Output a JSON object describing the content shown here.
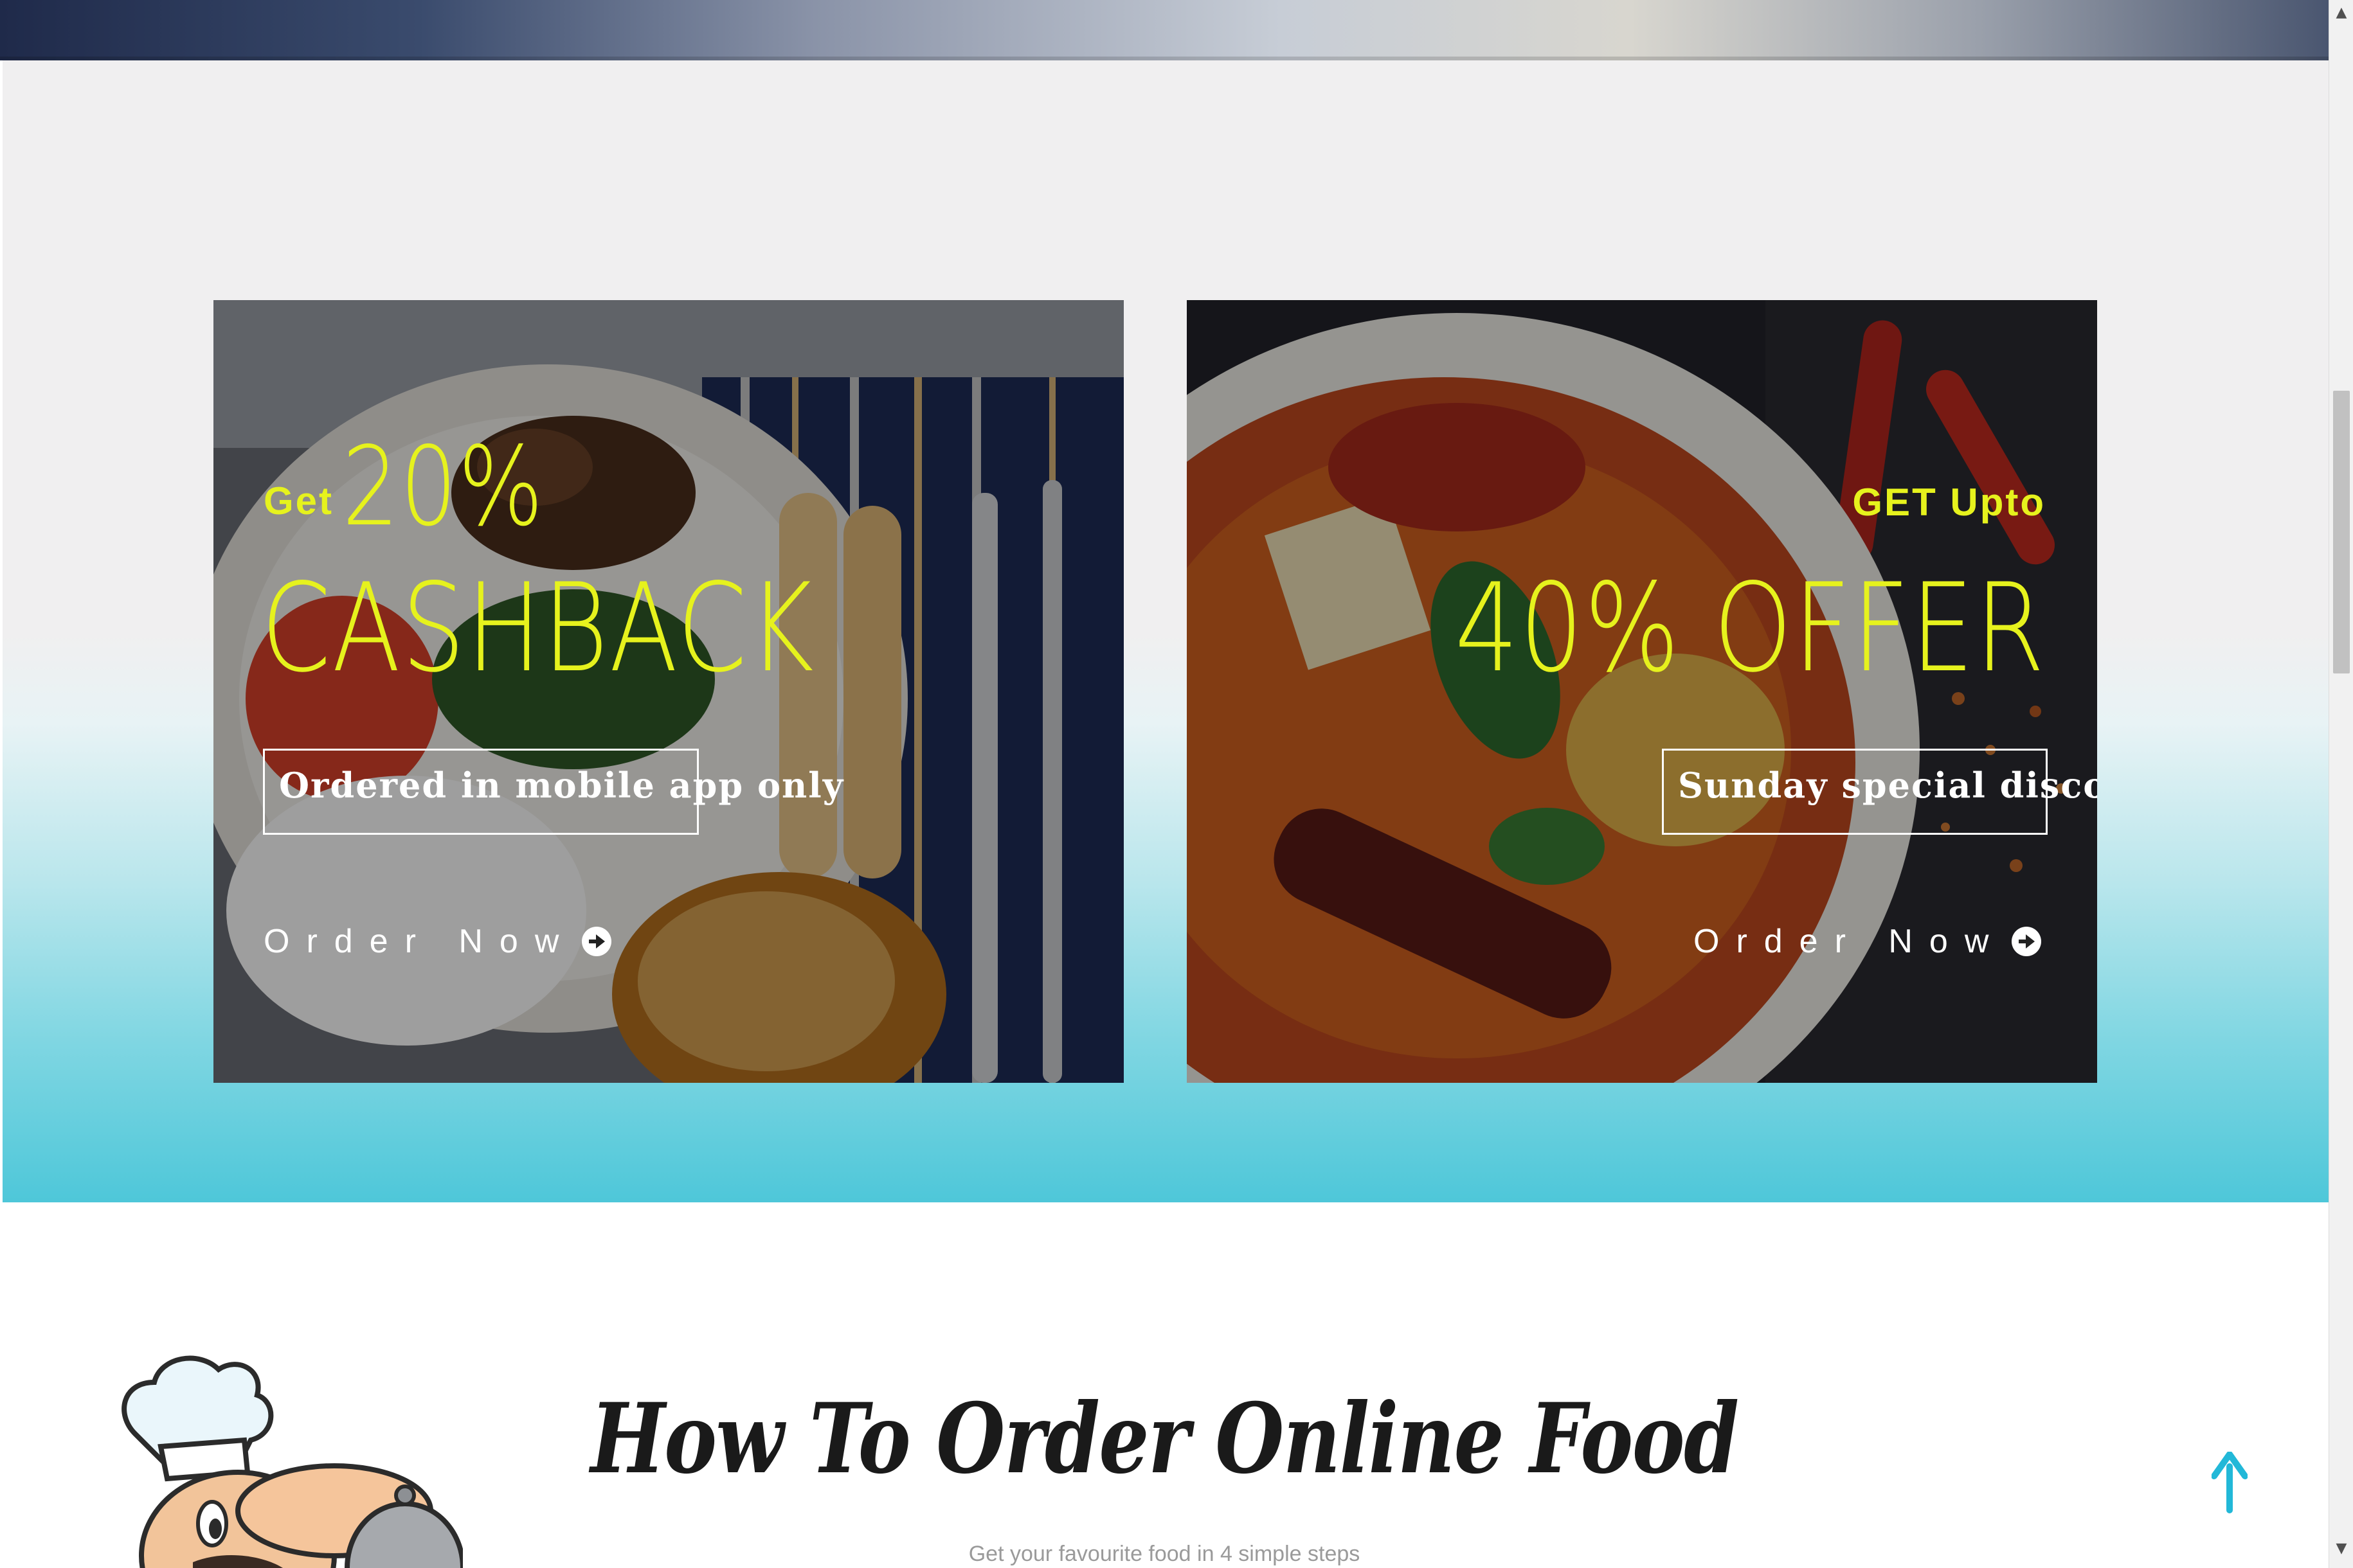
{
  "offers": {
    "left": {
      "kicker": "Get",
      "percent": "20%",
      "headline": "CASHBACK",
      "tag": "Ordered in mobile app only",
      "cta": "Order Now"
    },
    "right": {
      "kicker": "GET Upto",
      "headline": "40% OFFER",
      "tag": "Sunday special discount",
      "cta": "Order Now"
    }
  },
  "how_to_order": {
    "title": "How To Order Online Food",
    "subtitle": "Get your favourite food in 4 simple steps"
  },
  "colors": {
    "accent": "#e6f21d",
    "teal": "#4ec7d9",
    "scroll_top_arrow": "#22b8d8"
  },
  "icons": {
    "order_arrow": "arrow-circle-right-icon",
    "scroll_top": "arrow-up-icon",
    "chef": "chef-illustration"
  }
}
